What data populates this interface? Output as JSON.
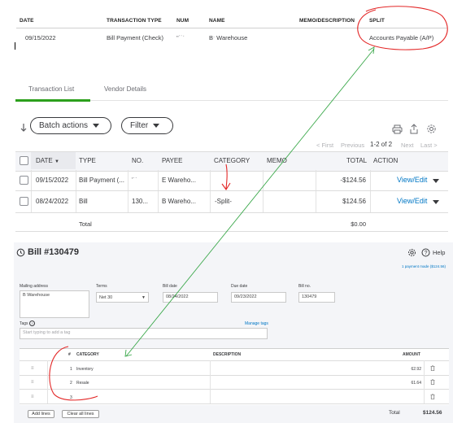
{
  "split_table": {
    "headers": {
      "date": "DATE",
      "type": "TRANSACTION TYPE",
      "num": "NUM",
      "name": "NAME",
      "memo": "MEMO/DESCRIPTION",
      "split": "SPLIT"
    },
    "row": {
      "date": "09/15/2022",
      "type": "Bill Payment (Check)",
      "num": "\"˙˙ˈ",
      "name": "Bˑ Warehouse",
      "split": "Accounts Payable (A/P)"
    }
  },
  "tabs": {
    "transaction_list": "Transaction List",
    "vendor_details": "Vendor Details"
  },
  "toolbar": {
    "batch_actions": "Batch actions",
    "filter": "Filter"
  },
  "pagination": {
    "first": "< First",
    "previous": "Previous",
    "range": "1-2 of 2",
    "next": "Next",
    "last": "Last >"
  },
  "tx_table": {
    "headers": {
      "date": "DATE",
      "type": "TYPE",
      "no": "NO.",
      "payee": "PAYEE",
      "category": "CATEGORY",
      "memo": "MEMO",
      "total": "TOTAL",
      "action": "ACTION"
    },
    "rows": [
      {
        "date": "09/15/2022",
        "type": "Bill Payment (...",
        "no": "'˙˙",
        "payee": "E   Wareho...",
        "category": "",
        "total": "-$124.56",
        "action": "View/Edit"
      },
      {
        "date": "08/24/2022",
        "type": "Bill",
        "no": "130...",
        "payee": "B   Wareho...",
        "category": "-Split-",
        "total": "$124.56",
        "action": "View/Edit"
      }
    ],
    "footer": {
      "label": "Total",
      "value": "$0.00"
    }
  },
  "bill": {
    "title": "Bill #130479",
    "help": "Help",
    "payment_made": "1 payment made ($124.56)",
    "mailing_label": "Mailing address",
    "mailing_value": "B   Warehouse",
    "terms_label": "Terms",
    "terms_value": "Net 30",
    "bill_date_label": "Bill date",
    "bill_date_value": "08/24/2022",
    "due_date_label": "Due date",
    "due_date_value": "09/23/2022",
    "bill_no_label": "Bill no.",
    "bill_no_value": "130479",
    "tags_label": "Tags",
    "manage_tags": "Manage tags",
    "tags_placeholder": "Start typing to add a tag",
    "lines_headers": {
      "num": "#",
      "category": "CATEGORY",
      "description": "DESCRIPTION",
      "amount": "AMOUNT"
    },
    "lines": [
      {
        "num": "1",
        "category": "Inventory",
        "amount": "62.92"
      },
      {
        "num": "2",
        "category": "Resale",
        "amount": "61.64"
      },
      {
        "num": "3",
        "category": "",
        "amount": ""
      }
    ],
    "add_lines": "Add lines",
    "clear_lines": "Clear all lines",
    "total_label": "Total",
    "total_value": "$124.56"
  }
}
